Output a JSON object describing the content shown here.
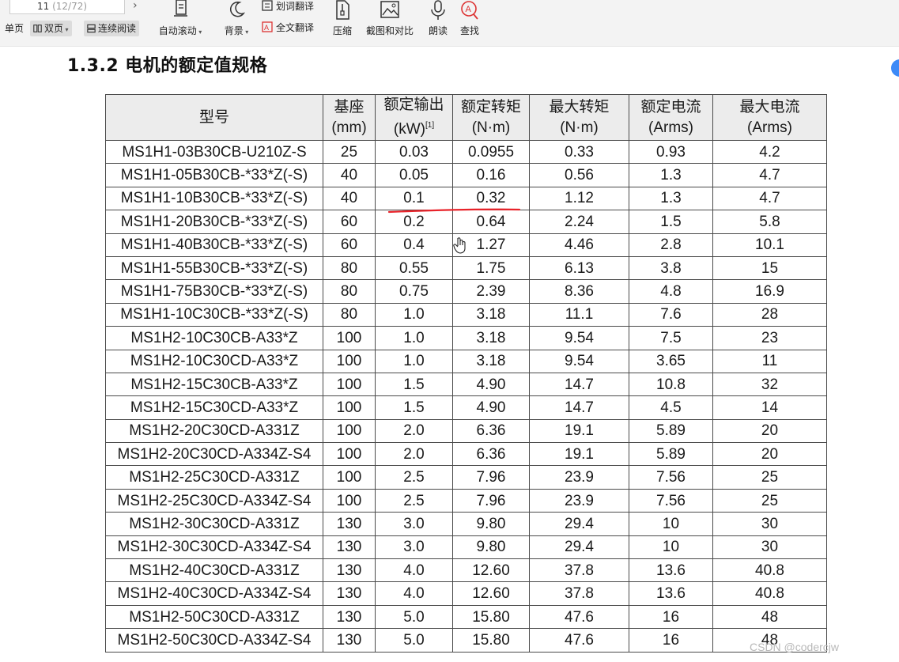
{
  "toolbar": {
    "page_current": "11",
    "page_total": "(12/72)",
    "next_arrow": "›",
    "view_single": "单页",
    "view_double": "双页",
    "view_continuous": "连续阅读",
    "auto_scroll": "自动滚动",
    "background": "背景",
    "word_translate": "划词翻译",
    "full_translate": "全文翻译",
    "compress": "压缩",
    "screenshot_compare": "截图和对比",
    "read_aloud": "朗读",
    "find": "查找"
  },
  "document": {
    "section_title": "1.3.2 电机的额定值规格",
    "table": {
      "headers": [
        {
          "line1": "型号",
          "line2": ""
        },
        {
          "line1": "基座",
          "line2": "(mm)"
        },
        {
          "line1": "额定输出",
          "line2": "(kW)",
          "sup": "[1]"
        },
        {
          "line1": "额定转矩",
          "line2": "(N·m)"
        },
        {
          "line1": "最大转矩",
          "line2": "(N·m)"
        },
        {
          "line1": "额定电流",
          "line2": "(Arms)"
        },
        {
          "line1": "最大电流",
          "line2": "(Arms)"
        }
      ],
      "rows": [
        [
          "MS1H1-03B30CB-U210Z-S",
          "25",
          "0.03",
          "0.0955",
          "0.33",
          "0.93",
          "4.2"
        ],
        [
          "MS1H1-05B30CB-*33*Z(-S)",
          "40",
          "0.05",
          "0.16",
          "0.56",
          "1.3",
          "4.7"
        ],
        [
          "MS1H1-10B30CB-*33*Z(-S)",
          "40",
          "0.1",
          "0.32",
          "1.12",
          "1.3",
          "4.7"
        ],
        [
          "MS1H1-20B30CB-*33*Z(-S)",
          "60",
          "0.2",
          "0.64",
          "2.24",
          "1.5",
          "5.8"
        ],
        [
          "MS1H1-40B30CB-*33*Z(-S)",
          "60",
          "0.4",
          "1.27",
          "4.46",
          "2.8",
          "10.1"
        ],
        [
          "MS1H1-55B30CB-*33*Z(-S)",
          "80",
          "0.55",
          "1.75",
          "6.13",
          "3.8",
          "15"
        ],
        [
          "MS1H1-75B30CB-*33*Z(-S)",
          "80",
          "0.75",
          "2.39",
          "8.36",
          "4.8",
          "16.9"
        ],
        [
          "MS1H1-10C30CB-*33*Z(-S)",
          "80",
          "1.0",
          "3.18",
          "11.1",
          "7.6",
          "28"
        ],
        [
          "MS1H2-10C30CB-A33*Z",
          "100",
          "1.0",
          "3.18",
          "9.54",
          "7.5",
          "23"
        ],
        [
          "MS1H2-10C30CD-A33*Z",
          "100",
          "1.0",
          "3.18",
          "9.54",
          "3.65",
          "11"
        ],
        [
          "MS1H2-15C30CB-A33*Z",
          "100",
          "1.5",
          "4.90",
          "14.7",
          "10.8",
          "32"
        ],
        [
          "MS1H2-15C30CD-A33*Z",
          "100",
          "1.5",
          "4.90",
          "14.7",
          "4.5",
          "14"
        ],
        [
          "MS1H2-20C30CD-A331Z",
          "100",
          "2.0",
          "6.36",
          "19.1",
          "5.89",
          "20"
        ],
        [
          "MS1H2-20C30CD-A334Z-S4",
          "100",
          "2.0",
          "6.36",
          "19.1",
          "5.89",
          "20"
        ],
        [
          "MS1H2-25C30CD-A331Z",
          "100",
          "2.5",
          "7.96",
          "23.9",
          "7.56",
          "25"
        ],
        [
          "MS1H2-25C30CD-A334Z-S4",
          "100",
          "2.5",
          "7.96",
          "23.9",
          "7.56",
          "25"
        ],
        [
          "MS1H2-30C30CD-A331Z",
          "130",
          "3.0",
          "9.80",
          "29.4",
          "10",
          "30"
        ],
        [
          "MS1H2-30C30CD-A334Z-S4",
          "130",
          "3.0",
          "9.80",
          "29.4",
          "10",
          "30"
        ],
        [
          "MS1H2-40C30CD-A331Z",
          "130",
          "4.0",
          "12.60",
          "37.8",
          "13.6",
          "40.8"
        ],
        [
          "MS1H2-40C30CD-A334Z-S4",
          "130",
          "4.0",
          "12.60",
          "37.8",
          "13.6",
          "40.8"
        ],
        [
          "MS1H2-50C30CD-A331Z",
          "130",
          "5.0",
          "15.80",
          "47.6",
          "16",
          "48"
        ],
        [
          "MS1H2-50C30CD-A334Z-S4",
          "130",
          "5.0",
          "15.80",
          "47.6",
          "16",
          "48"
        ]
      ]
    }
  },
  "watermark": "CSDN @codercjw",
  "colors": {
    "annotation_red": "#e8232a",
    "toolbar_bg": "#f3f3f3",
    "header_bg": "#ececec",
    "badge_blue": "#3d8af7"
  }
}
